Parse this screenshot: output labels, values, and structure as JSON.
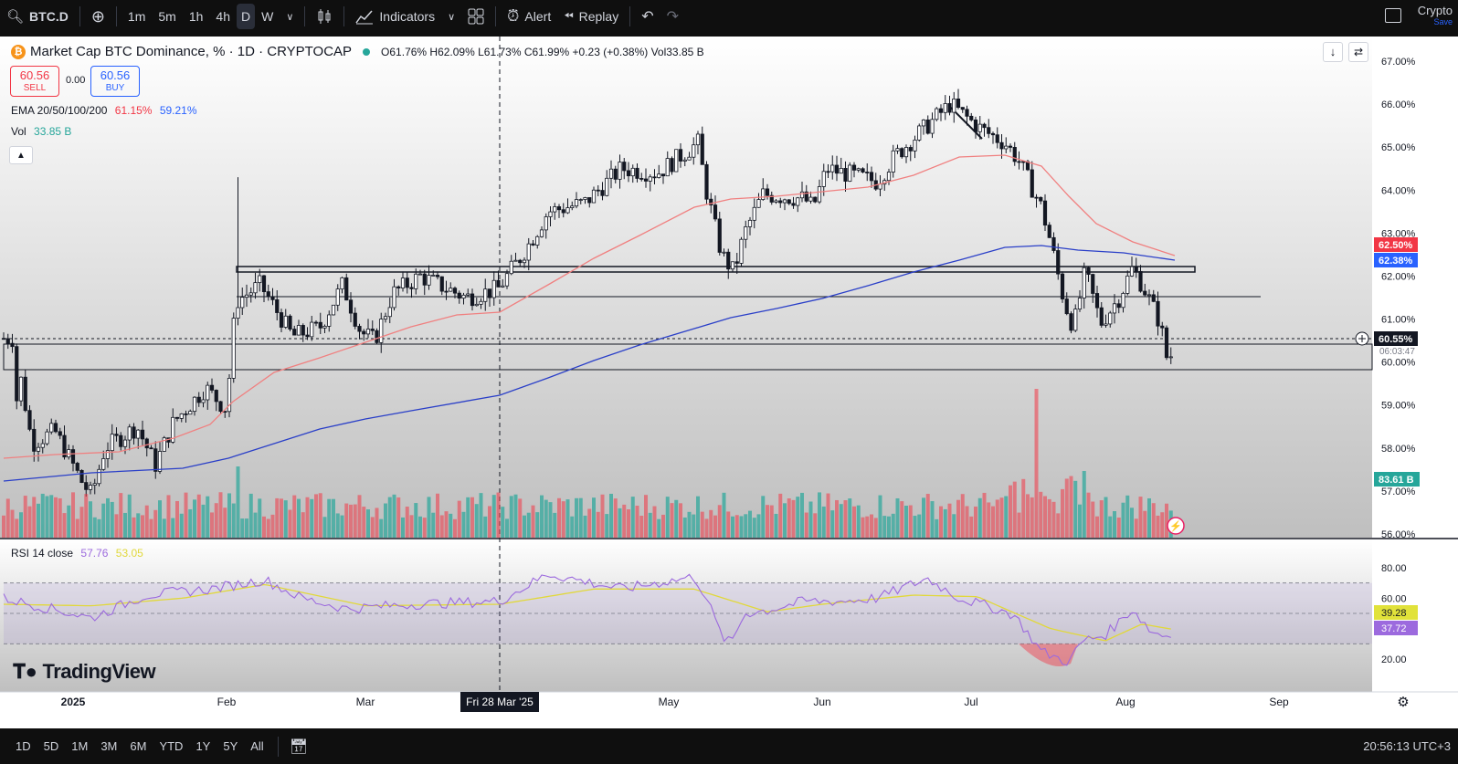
{
  "toolbar": {
    "symbol": "BTC.D",
    "intervals": [
      "1m",
      "5m",
      "1h",
      "4h",
      "D",
      "W"
    ],
    "selected_interval": "D",
    "indicators_label": "Indicators",
    "alert_label": "Alert",
    "replay_label": "Replay",
    "account_label": "Crypto",
    "account_sub": "Save"
  },
  "legend": {
    "title": "Market Cap BTC Dominance, % · 1D · CRYPTOCAP",
    "ohlc": "O61.76% H62.09% L61.73% C61.99% +0.23 (+0.38%) Vol33.85 B",
    "sell_price": "60.56",
    "sell_label": "SELL",
    "spread": "0.00",
    "buy_price": "60.56",
    "buy_label": "BUY",
    "ema_label": "EMA 20/50/100/200",
    "ema_v1": "61.15%",
    "ema_v2": "59.21%",
    "vol_label": "Vol",
    "vol_value": "33.85 B",
    "rsi_label": "RSI 14 close",
    "rsi_v1": "57.76",
    "rsi_v2": "53.05",
    "watermark": "TradingView"
  },
  "price_axis": {
    "ticks": [
      "67.00%",
      "66.00%",
      "65.00%",
      "64.00%",
      "63.00%",
      "62.00%",
      "61.00%",
      "60.00%",
      "59.00%",
      "58.00%",
      "57.00%",
      "56.00%"
    ],
    "label_ema50": "62.50%",
    "label_ema200": "62.38%",
    "label_last": "60.55%",
    "label_countdown": "06:03:47",
    "label_volume": "83.61 B",
    "colors": {
      "ema50": "#f23645",
      "ema200": "#2962ff",
      "last": "#131722",
      "volume": "#26a69a"
    }
  },
  "rsi_axis": {
    "ticks": [
      "80.00",
      "60.00",
      "20.00"
    ],
    "label_ma": "39.28",
    "label_rsi": "37.72"
  },
  "time_axis": {
    "labels": [
      "2025",
      "Feb",
      "Mar",
      "May",
      "Jun",
      "Jul",
      "Aug",
      "Sep"
    ],
    "crosshair_label": "Fri 28 Mar '25"
  },
  "bottom_bar": {
    "ranges": [
      "1D",
      "5D",
      "1M",
      "3M",
      "6M",
      "YTD",
      "1Y",
      "5Y",
      "All"
    ],
    "clock": "20:56:13 UTC+3"
  },
  "chart_data": {
    "type": "candlestick",
    "title": "Market Cap BTC Dominance, %",
    "interval": "1D",
    "ylim": [
      56.0,
      67.3
    ],
    "key_points": [
      {
        "date": "2025-01-01",
        "close": 58.6
      },
      {
        "date": "2025-01-20",
        "close": 57.6
      },
      {
        "date": "2025-02-03",
        "close": 61.3
      },
      {
        "date": "2025-03-10",
        "close": 60.4
      },
      {
        "date": "2025-03-28",
        "close": 61.7
      },
      {
        "date": "2025-04-25",
        "close": 64.5
      },
      {
        "date": "2025-05-09",
        "close": 65.2
      },
      {
        "date": "2025-05-15",
        "close": 62.2
      },
      {
        "date": "2025-06-27",
        "close": 65.9
      },
      {
        "date": "2025-07-14",
        "close": 64.9
      },
      {
        "date": "2025-07-22",
        "close": 61.0
      },
      {
        "date": "2025-08-05",
        "close": 62.2
      },
      {
        "date": "2025-08-11",
        "close": 59.9
      },
      {
        "date": "2025-08-12",
        "close": 60.55
      }
    ],
    "horizontal_levels": [
      62.2,
      61.5,
      60.5,
      59.85
    ],
    "ema_last": {
      "ema50": 62.5,
      "ema200": 62.38
    },
    "last_price": 60.55,
    "rsi": {
      "ylim": [
        20,
        80
      ],
      "bands": [
        70,
        50,
        30
      ],
      "last_rsi": 37.72,
      "last_ma": 39.28
    }
  }
}
